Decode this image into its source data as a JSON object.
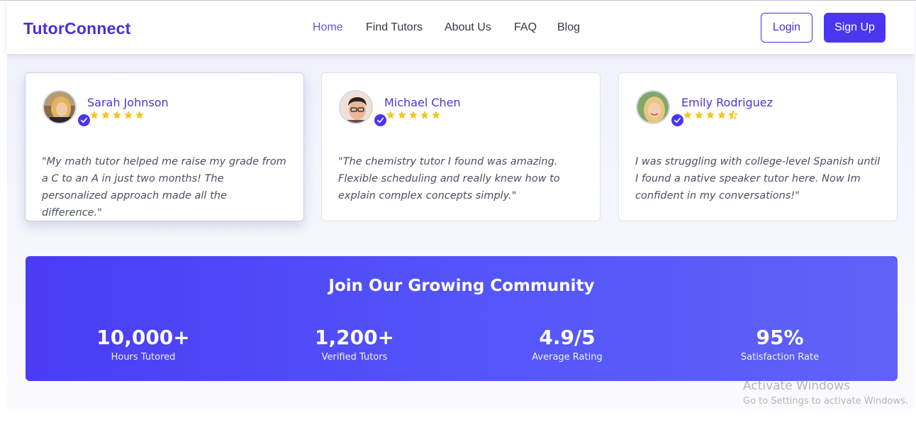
{
  "brand": {
    "logo_text": "TutorConnect",
    "accent_color": "#4a36f0"
  },
  "nav": {
    "items": [
      {
        "label": "Home",
        "active": true
      },
      {
        "label": "Find Tutors",
        "active": false
      },
      {
        "label": "About Us",
        "active": false
      },
      {
        "label": "FAQ",
        "active": false
      },
      {
        "label": "Blog",
        "active": false
      }
    ],
    "login_label": "Login",
    "signup_label": "Sign Up"
  },
  "testimonials": [
    {
      "name": "Sarah Johnson",
      "rating": 5,
      "verified": true,
      "avatar": "avatar-photo-blonde-woman",
      "quote": "\"My math tutor helped me raise my grade from a C to an A in just two months! The personalized approach made all the difference.\""
    },
    {
      "name": "Michael Chen",
      "rating": 5,
      "verified": true,
      "avatar": "avatar-photo-man-glasses",
      "quote": "\"The chemistry tutor I found was amazing. Flexible scheduling and really knew how to explain complex concepts simply.\""
    },
    {
      "name": "Emily Rodriguez",
      "rating": 4.5,
      "verified": true,
      "avatar": "avatar-photo-smiling-woman",
      "quote": "I was struggling with college-level Spanish until I found a native speaker tutor here. Now Im confident in my conversations!\""
    }
  ],
  "community": {
    "title": "Join Our Growing Community",
    "stats": [
      {
        "value": "10,000+",
        "label": "Hours Tutored"
      },
      {
        "value": "1,200+",
        "label": "Verified Tutors"
      },
      {
        "value": "4.9/5",
        "label": "Average Rating"
      },
      {
        "value": "95%",
        "label": "Satisfaction Rate"
      }
    ]
  },
  "watermark": {
    "title": "Activate Windows",
    "subtitle": "Go to Settings to activate Windows."
  },
  "colors": {
    "star": "#f5c518",
    "banner_start": "#4a3cf5",
    "banner_end": "#6062f7"
  }
}
